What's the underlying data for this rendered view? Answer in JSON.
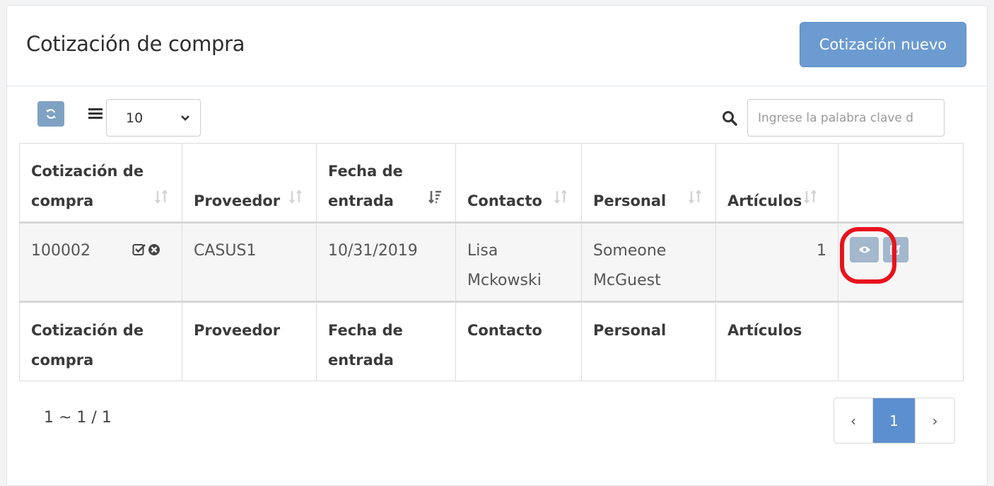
{
  "header": {
    "title": "Cotización de compra",
    "new_button": "Cotización nuevo"
  },
  "toolbar": {
    "refresh_icon": "refresh-icon",
    "page_size": "10",
    "search_placeholder": "Ingrese la palabra clave d"
  },
  "table": {
    "columns": [
      "Cotización de compra",
      "Proveedor",
      "Fecha de entrada",
      "Contacto",
      "Personal",
      "Artículos"
    ],
    "rows": [
      {
        "id": "100002",
        "proveedor": "CASUS1",
        "fecha": "10/31/2019",
        "contacto": "Lisa Mckowski",
        "personal": "Someone McGuest",
        "articulos": "1"
      }
    ]
  },
  "pagination": {
    "summary": "1 ~ 1 / 1",
    "prev": "‹",
    "current": "1",
    "next": "›"
  },
  "colors": {
    "primary": "#6b9bd1",
    "highlight": "#e8131d"
  }
}
